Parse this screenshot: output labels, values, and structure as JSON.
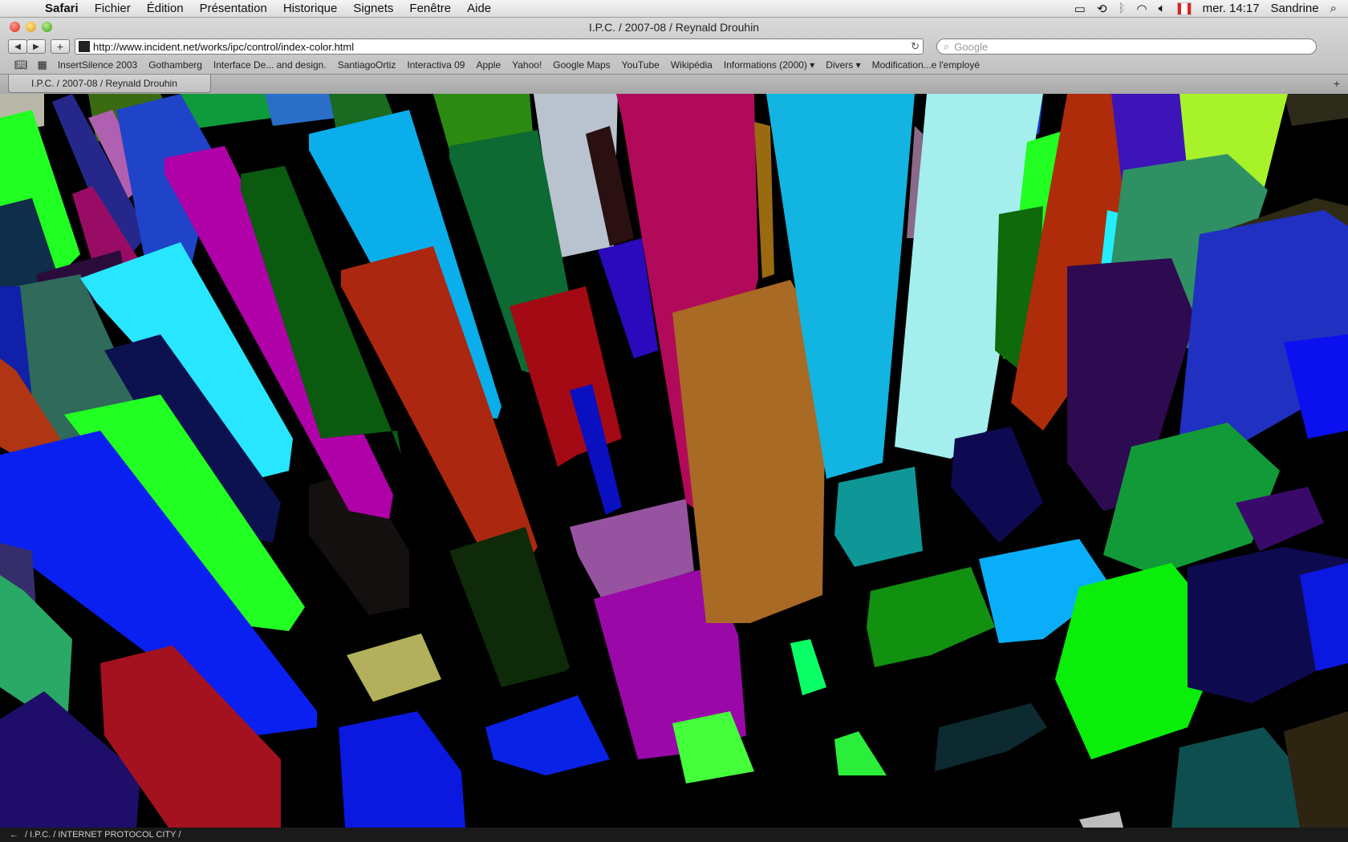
{
  "menubar": {
    "app": "Safari",
    "items": [
      "Fichier",
      "Édition",
      "Présentation",
      "Historique",
      "Signets",
      "Fenêtre",
      "Aide"
    ],
    "datetime": "mer. 14:17",
    "user": "Sandrine",
    "flag_text": "CSA"
  },
  "window": {
    "title": "I.P.C. / 2007-08 / Reynald Drouhin"
  },
  "toolbar": {
    "url": "http://www.incident.net/works/ipc/control/index-color.html",
    "search_placeholder": "Google"
  },
  "bookmarks": [
    "InsertSilence 2003",
    "Gothamberg",
    "Interface De... and design.",
    "SantiagoOrtiz",
    "Interactiva 09",
    "Apple",
    "Yahoo!",
    "Google Maps",
    "YouTube",
    "Wikipédia",
    "Informations (2000) ▾",
    "Divers ▾",
    "Modification...e l'employé"
  ],
  "tab": {
    "label": "I.P.C. / 2007-08 / Reynald Drouhin"
  },
  "status": {
    "arrow": "←",
    "text": "/ I.P.C. / INTERNET PROTOCOL CITY /"
  }
}
